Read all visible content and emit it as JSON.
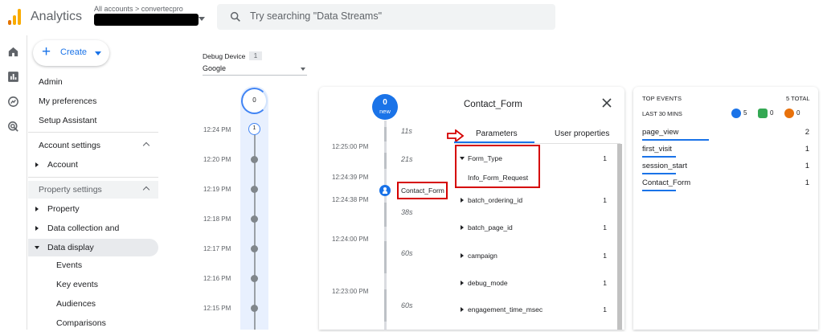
{
  "topbar": {
    "app_title": "Analytics",
    "account_breadcrumb": "All accounts > convertecpro",
    "search_placeholder": "Try searching \"Data Streams\""
  },
  "colors": {
    "accent": "#1a73e8",
    "highlight_red": "#d50000",
    "logo_orange": "#f9ab00",
    "logo_dark_orange": "#e37400"
  },
  "rail_icons": [
    "home-icon",
    "reports-icon",
    "explore-icon",
    "advertising-icon"
  ],
  "nav": {
    "create_label": "Create",
    "items": {
      "admin": "Admin",
      "prefs": "My preferences",
      "setup": "Setup Assistant",
      "account_settings": "Account settings",
      "account": "Account",
      "property_settings": "Property settings",
      "property": "Property",
      "data_collection": "Data collection and modifica...",
      "data_display": "Data display",
      "events": "Events",
      "key_events": "Key events",
      "audiences": "Audiences",
      "comparisons": "Comparisons"
    }
  },
  "debug": {
    "device_label": "Debug Device",
    "device_count": "1",
    "device_value": "Google"
  },
  "minutes": {
    "top_count": "0",
    "ring_count": "1",
    "times": [
      "12:24 PM",
      "12:20 PM",
      "12:19 PM",
      "12:18 PM",
      "12:17 PM",
      "12:16 PM",
      "12:15 PM"
    ]
  },
  "seconds": {
    "new_count": "0",
    "new_label": "new",
    "durations": [
      "11s",
      "21s",
      "38s",
      "60s",
      "60s"
    ],
    "times": [
      "12:25:00 PM",
      "12:24:39 PM",
      "12:24:38 PM",
      "12:24:00 PM",
      "12:23:00 PM"
    ],
    "event_chip": "Contact_Form"
  },
  "details": {
    "title": "Contact_Form",
    "tabs": [
      "Parameters",
      "User properties"
    ],
    "params": [
      {
        "name": "Form_Type",
        "count": "1",
        "value": "Info_Form_Request"
      },
      {
        "name": "batch_ordering_id",
        "count": "1"
      },
      {
        "name": "batch_page_id",
        "count": "1"
      },
      {
        "name": "campaign",
        "count": "1"
      },
      {
        "name": "debug_mode",
        "count": "1"
      },
      {
        "name": "engagement_time_msec",
        "count": "1"
      }
    ]
  },
  "top_events": {
    "title": "TOP EVENTS",
    "total": "5 TOTAL",
    "window": "LAST 30 MINS",
    "stats": [
      {
        "icon": "event-icon",
        "color": "#1a73e8",
        "count": "5"
      },
      {
        "icon": "key-event-icon",
        "color": "#34a853",
        "count": "0"
      },
      {
        "icon": "error-icon",
        "color": "#e8710a",
        "count": "0"
      }
    ],
    "rows": [
      {
        "name": "page_view",
        "count": "2",
        "share": 0.4
      },
      {
        "name": "first_visit",
        "count": "1",
        "share": 0.2
      },
      {
        "name": "session_start",
        "count": "1",
        "share": 0.2
      },
      {
        "name": "Contact_Form",
        "count": "1",
        "share": 0.2
      }
    ]
  }
}
